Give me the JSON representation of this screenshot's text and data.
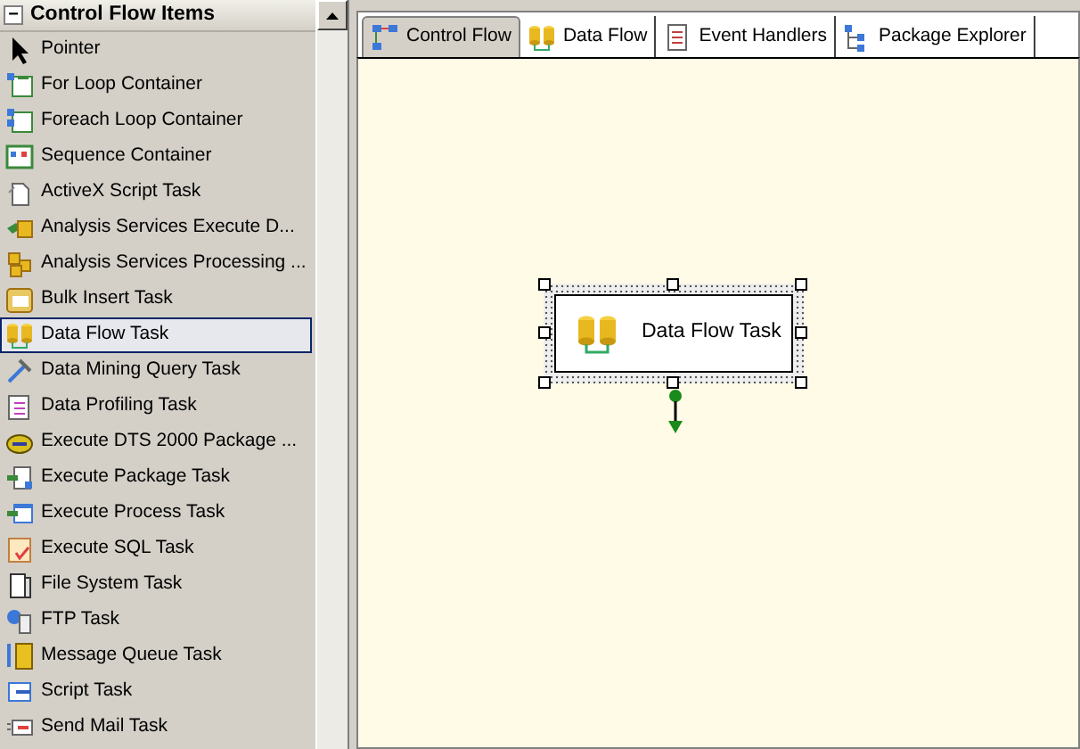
{
  "toolbox": {
    "title": "Control Flow Items",
    "collapse_glyph": "−",
    "items": [
      {
        "label": "Pointer",
        "selected": false
      },
      {
        "label": "For Loop Container",
        "selected": false
      },
      {
        "label": "Foreach Loop Container",
        "selected": false
      },
      {
        "label": "Sequence Container",
        "selected": false
      },
      {
        "label": "ActiveX Script Task",
        "selected": false
      },
      {
        "label": "Analysis Services Execute D...",
        "selected": false
      },
      {
        "label": "Analysis Services Processing ...",
        "selected": false
      },
      {
        "label": "Bulk Insert Task",
        "selected": false
      },
      {
        "label": "Data Flow Task",
        "selected": true
      },
      {
        "label": "Data Mining Query Task",
        "selected": false
      },
      {
        "label": "Data Profiling Task",
        "selected": false
      },
      {
        "label": "Execute DTS 2000 Package ...",
        "selected": false
      },
      {
        "label": "Execute Package Task",
        "selected": false
      },
      {
        "label": "Execute Process Task",
        "selected": false
      },
      {
        "label": "Execute SQL Task",
        "selected": false
      },
      {
        "label": "File System Task",
        "selected": false
      },
      {
        "label": "FTP Task",
        "selected": false
      },
      {
        "label": "Message Queue Task",
        "selected": false
      },
      {
        "label": "Script Task",
        "selected": false
      },
      {
        "label": "Send Mail Task",
        "selected": false
      }
    ]
  },
  "tabs": [
    {
      "label": "Control Flow",
      "selected": true
    },
    {
      "label": "Data Flow",
      "selected": false
    },
    {
      "label": "Event Handlers",
      "selected": false
    },
    {
      "label": "Package Explorer",
      "selected": false
    }
  ],
  "canvas": {
    "tasks": [
      {
        "label": "Data Flow Task",
        "selected": true
      }
    ]
  }
}
